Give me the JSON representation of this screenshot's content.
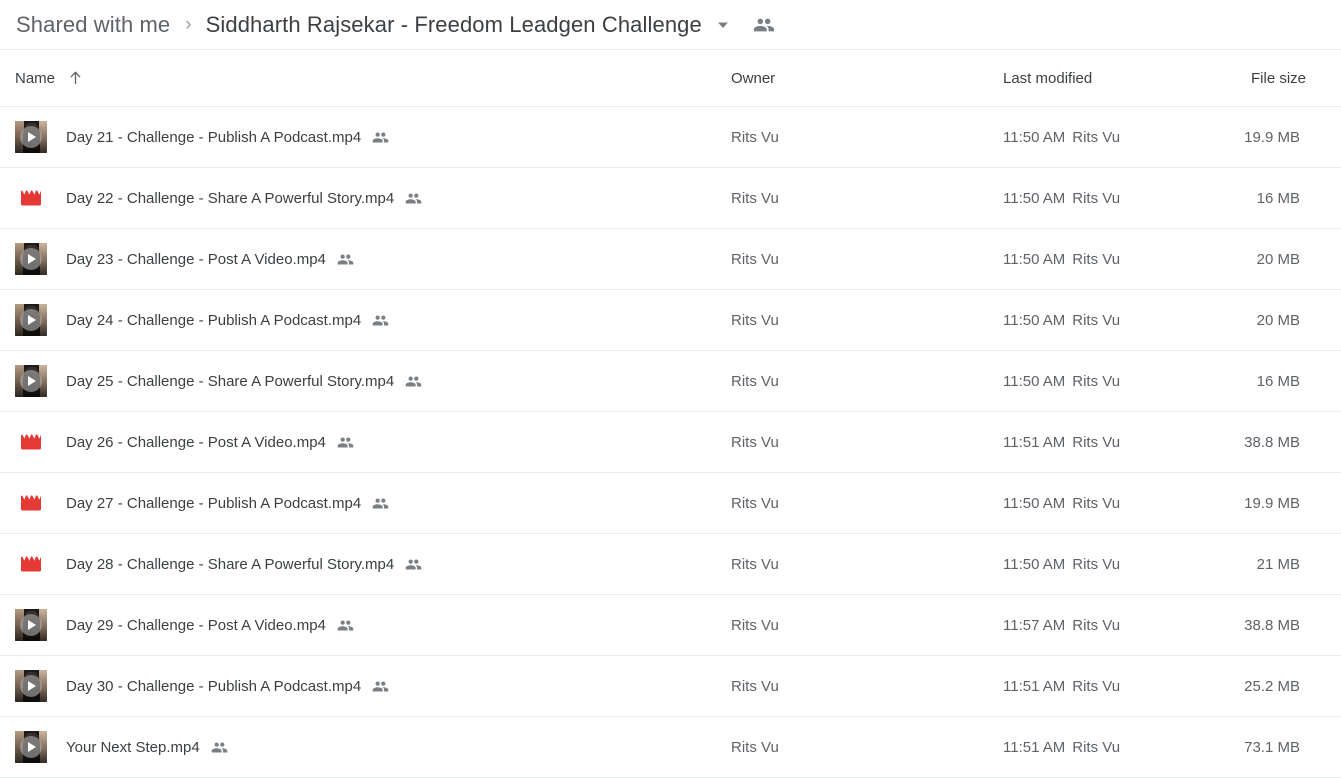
{
  "breadcrumb": {
    "parent": "Shared with me",
    "separator": "›",
    "current": "Siddharth Rajsekar - Freedom Leadgen Challenge",
    "caret_icon": "chevron-down-icon",
    "shared_icon": "people-shared-icon"
  },
  "columns": {
    "name": "Name",
    "sort_icon": "sort-ascending-arrow-icon",
    "owner": "Owner",
    "modified": "Last modified",
    "size": "File size"
  },
  "files": [
    {
      "icon": "video-thumbnail",
      "name": "Day 21 - Challenge - Publish A Podcast.mp4",
      "shared_icon": "people-shared-icon",
      "owner": "Rits Vu",
      "modified_time": "11:50 AM",
      "modified_by": "Rits Vu",
      "size": "19.9 MB"
    },
    {
      "icon": "clapperboard",
      "name": "Day 22 - Challenge - Share A Powerful Story.mp4",
      "shared_icon": "people-shared-icon",
      "owner": "Rits Vu",
      "modified_time": "11:50 AM",
      "modified_by": "Rits Vu",
      "size": "16 MB"
    },
    {
      "icon": "video-thumbnail",
      "name": "Day 23 - Challenge - Post A Video.mp4",
      "shared_icon": "people-shared-icon",
      "owner": "Rits Vu",
      "modified_time": "11:50 AM",
      "modified_by": "Rits Vu",
      "size": "20 MB"
    },
    {
      "icon": "video-thumbnail",
      "name": "Day 24 - Challenge - Publish A Podcast.mp4",
      "shared_icon": "people-shared-icon",
      "owner": "Rits Vu",
      "modified_time": "11:50 AM",
      "modified_by": "Rits Vu",
      "size": "20 MB"
    },
    {
      "icon": "video-thumbnail",
      "name": "Day 25 - Challenge - Share A Powerful Story.mp4",
      "shared_icon": "people-shared-icon",
      "owner": "Rits Vu",
      "modified_time": "11:50 AM",
      "modified_by": "Rits Vu",
      "size": "16 MB"
    },
    {
      "icon": "clapperboard",
      "name": "Day 26 - Challenge - Post A Video.mp4",
      "shared_icon": "people-shared-icon",
      "owner": "Rits Vu",
      "modified_time": "11:51 AM",
      "modified_by": "Rits Vu",
      "size": "38.8 MB"
    },
    {
      "icon": "clapperboard",
      "name": "Day 27 - Challenge - Publish A Podcast.mp4",
      "shared_icon": "people-shared-icon",
      "owner": "Rits Vu",
      "modified_time": "11:50 AM",
      "modified_by": "Rits Vu",
      "size": "19.9 MB"
    },
    {
      "icon": "clapperboard",
      "name": "Day 28 - Challenge - Share A Powerful Story.mp4",
      "shared_icon": "people-shared-icon",
      "owner": "Rits Vu",
      "modified_time": "11:50 AM",
      "modified_by": "Rits Vu",
      "size": "21 MB"
    },
    {
      "icon": "video-thumbnail",
      "name": "Day 29 - Challenge - Post A Video.mp4",
      "shared_icon": "people-shared-icon",
      "owner": "Rits Vu",
      "modified_time": "11:57 AM",
      "modified_by": "Rits Vu",
      "size": "38.8 MB"
    },
    {
      "icon": "video-thumbnail",
      "name": "Day 30 - Challenge - Publish A Podcast.mp4",
      "shared_icon": "people-shared-icon",
      "owner": "Rits Vu",
      "modified_time": "11:51 AM",
      "modified_by": "Rits Vu",
      "size": "25.2 MB"
    },
    {
      "icon": "video-thumbnail",
      "name": "Your Next Step.mp4",
      "shared_icon": "people-shared-icon",
      "owner": "Rits Vu",
      "modified_time": "11:51 AM",
      "modified_by": "Rits Vu",
      "size": "73.1 MB"
    }
  ],
  "colors": {
    "clapperboard_red": "#e53935",
    "text_primary": "#3c4043",
    "text_secondary": "#5f6368",
    "divider": "#e8eaed",
    "icon_gray": "#7b7f83"
  }
}
